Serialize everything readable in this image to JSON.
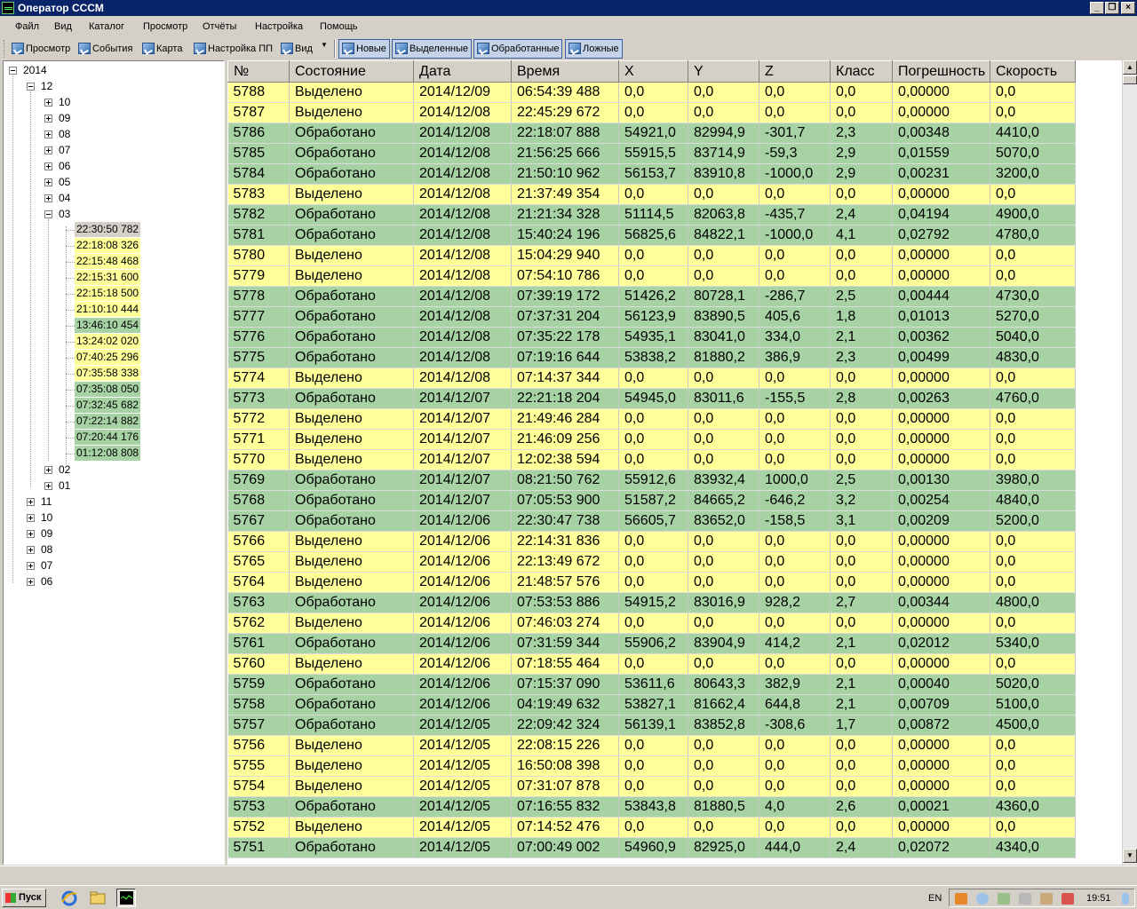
{
  "window": {
    "title": "Оператор СССМ"
  },
  "menu": [
    "Файл",
    "Вид",
    "Каталог",
    "Просмотр",
    "Отчёты",
    "Настройка",
    "Помощь"
  ],
  "toolbar": {
    "buttons": [
      "Просмотр",
      "События",
      "Карта",
      "Настройка ПП",
      "Вид"
    ],
    "filters": [
      "Новые",
      "Выделенные",
      "Обработанные",
      "Ложные"
    ]
  },
  "tree": {
    "year": "2014",
    "month_open": "12",
    "days_collapsed_top": [
      "10",
      "09",
      "08",
      "07",
      "06",
      "05",
      "04"
    ],
    "day_open": "03",
    "events": [
      {
        "t": "22:30:50 782",
        "status": "yellow",
        "selected": true
      },
      {
        "t": "22:18:08 326",
        "status": "yellow"
      },
      {
        "t": "22:15:48 468",
        "status": "yellow"
      },
      {
        "t": "22:15:31 600",
        "status": "yellow"
      },
      {
        "t": "22:15:18 500",
        "status": "yellow"
      },
      {
        "t": "21:10:10 444",
        "status": "yellow"
      },
      {
        "t": "13:46:10 454",
        "status": "green"
      },
      {
        "t": "13:24:02 020",
        "status": "yellow"
      },
      {
        "t": "07:40:25 296",
        "status": "yellow"
      },
      {
        "t": "07:35:58 338",
        "status": "yellow"
      },
      {
        "t": "07:35:08 050",
        "status": "green"
      },
      {
        "t": "07:32:45 682",
        "status": "green"
      },
      {
        "t": "07:22:14 882",
        "status": "green"
      },
      {
        "t": "07:20:44 176",
        "status": "green"
      },
      {
        "t": "01:12:08 808",
        "status": "green"
      }
    ],
    "days_collapsed_bottom": [
      "02",
      "01"
    ],
    "months_collapsed": [
      "11",
      "10",
      "09",
      "08",
      "07",
      "06"
    ]
  },
  "table": {
    "columns": [
      "№",
      "Состояние",
      "Дата",
      "Время",
      "X",
      "Y",
      "Z",
      "Класс",
      "Погрешность",
      "Скорость"
    ],
    "rows": [
      [
        "5788",
        "Выделено",
        "2014/12/09",
        "06:54:39 488",
        "0,0",
        "0,0",
        "0,0",
        "0,0",
        "0,00000",
        "0,0"
      ],
      [
        "5787",
        "Выделено",
        "2014/12/08",
        "22:45:29 672",
        "0,0",
        "0,0",
        "0,0",
        "0,0",
        "0,00000",
        "0,0"
      ],
      [
        "5786",
        "Обработано",
        "2014/12/08",
        "22:18:07 888",
        "54921,0",
        "82994,9",
        "-301,7",
        "2,3",
        "0,00348",
        "4410,0"
      ],
      [
        "5785",
        "Обработано",
        "2014/12/08",
        "21:56:25 666",
        "55915,5",
        "83714,9",
        "-59,3",
        "2,9",
        "0,01559",
        "5070,0"
      ],
      [
        "5784",
        "Обработано",
        "2014/12/08",
        "21:50:10 962",
        "56153,7",
        "83910,8",
        "-1000,0",
        "2,9",
        "0,00231",
        "3200,0"
      ],
      [
        "5783",
        "Выделено",
        "2014/12/08",
        "21:37:49 354",
        "0,0",
        "0,0",
        "0,0",
        "0,0",
        "0,00000",
        "0,0"
      ],
      [
        "5782",
        "Обработано",
        "2014/12/08",
        "21:21:34 328",
        "51114,5",
        "82063,8",
        "-435,7",
        "2,4",
        "0,04194",
        "4900,0"
      ],
      [
        "5781",
        "Обработано",
        "2014/12/08",
        "15:40:24 196",
        "56825,6",
        "84822,1",
        "-1000,0",
        "4,1",
        "0,02792",
        "4780,0"
      ],
      [
        "5780",
        "Выделено",
        "2014/12/08",
        "15:04:29 940",
        "0,0",
        "0,0",
        "0,0",
        "0,0",
        "0,00000",
        "0,0"
      ],
      [
        "5779",
        "Выделено",
        "2014/12/08",
        "07:54:10 786",
        "0,0",
        "0,0",
        "0,0",
        "0,0",
        "0,00000",
        "0,0"
      ],
      [
        "5778",
        "Обработано",
        "2014/12/08",
        "07:39:19 172",
        "51426,2",
        "80728,1",
        "-286,7",
        "2,5",
        "0,00444",
        "4730,0"
      ],
      [
        "5777",
        "Обработано",
        "2014/12/08",
        "07:37:31 204",
        "56123,9",
        "83890,5",
        "405,6",
        "1,8",
        "0,01013",
        "5270,0"
      ],
      [
        "5776",
        "Обработано",
        "2014/12/08",
        "07:35:22 178",
        "54935,1",
        "83041,0",
        "334,0",
        "2,1",
        "0,00362",
        "5040,0"
      ],
      [
        "5775",
        "Обработано",
        "2014/12/08",
        "07:19:16 644",
        "53838,2",
        "81880,2",
        "386,9",
        "2,3",
        "0,00499",
        "4830,0"
      ],
      [
        "5774",
        "Выделено",
        "2014/12/08",
        "07:14:37 344",
        "0,0",
        "0,0",
        "0,0",
        "0,0",
        "0,00000",
        "0,0"
      ],
      [
        "5773",
        "Обработано",
        "2014/12/07",
        "22:21:18 204",
        "54945,0",
        "83011,6",
        "-155,5",
        "2,8",
        "0,00263",
        "4760,0"
      ],
      [
        "5772",
        "Выделено",
        "2014/12/07",
        "21:49:46 284",
        "0,0",
        "0,0",
        "0,0",
        "0,0",
        "0,00000",
        "0,0"
      ],
      [
        "5771",
        "Выделено",
        "2014/12/07",
        "21:46:09 256",
        "0,0",
        "0,0",
        "0,0",
        "0,0",
        "0,00000",
        "0,0"
      ],
      [
        "5770",
        "Выделено",
        "2014/12/07",
        "12:02:38 594",
        "0,0",
        "0,0",
        "0,0",
        "0,0",
        "0,00000",
        "0,0"
      ],
      [
        "5769",
        "Обработано",
        "2014/12/07",
        "08:21:50 762",
        "55912,6",
        "83932,4",
        "1000,0",
        "2,5",
        "0,00130",
        "3980,0"
      ],
      [
        "5768",
        "Обработано",
        "2014/12/07",
        "07:05:53 900",
        "51587,2",
        "84665,2",
        "-646,2",
        "3,2",
        "0,00254",
        "4840,0"
      ],
      [
        "5767",
        "Обработано",
        "2014/12/06",
        "22:30:47 738",
        "56605,7",
        "83652,0",
        "-158,5",
        "3,1",
        "0,00209",
        "5200,0"
      ],
      [
        "5766",
        "Выделено",
        "2014/12/06",
        "22:14:31 836",
        "0,0",
        "0,0",
        "0,0",
        "0,0",
        "0,00000",
        "0,0"
      ],
      [
        "5765",
        "Выделено",
        "2014/12/06",
        "22:13:49 672",
        "0,0",
        "0,0",
        "0,0",
        "0,0",
        "0,00000",
        "0,0"
      ],
      [
        "5764",
        "Выделено",
        "2014/12/06",
        "21:48:57 576",
        "0,0",
        "0,0",
        "0,0",
        "0,0",
        "0,00000",
        "0,0"
      ],
      [
        "5763",
        "Обработано",
        "2014/12/06",
        "07:53:53 886",
        "54915,2",
        "83016,9",
        "928,2",
        "2,7",
        "0,00344",
        "4800,0"
      ],
      [
        "5762",
        "Выделено",
        "2014/12/06",
        "07:46:03 274",
        "0,0",
        "0,0",
        "0,0",
        "0,0",
        "0,00000",
        "0,0"
      ],
      [
        "5761",
        "Обработано",
        "2014/12/06",
        "07:31:59 344",
        "55906,2",
        "83904,9",
        "414,2",
        "2,1",
        "0,02012",
        "5340,0"
      ],
      [
        "5760",
        "Выделено",
        "2014/12/06",
        "07:18:55 464",
        "0,0",
        "0,0",
        "0,0",
        "0,0",
        "0,00000",
        "0,0"
      ],
      [
        "5759",
        "Обработано",
        "2014/12/06",
        "07:15:37 090",
        "53611,6",
        "80643,3",
        "382,9",
        "2,1",
        "0,00040",
        "5020,0"
      ],
      [
        "5758",
        "Обработано",
        "2014/12/06",
        "04:19:49 632",
        "53827,1",
        "81662,4",
        "644,8",
        "2,1",
        "0,00709",
        "5100,0"
      ],
      [
        "5757",
        "Обработано",
        "2014/12/05",
        "22:09:42 324",
        "56139,1",
        "83852,8",
        "-308,6",
        "1,7",
        "0,00872",
        "4500,0"
      ],
      [
        "5756",
        "Выделено",
        "2014/12/05",
        "22:08:15 226",
        "0,0",
        "0,0",
        "0,0",
        "0,0",
        "0,00000",
        "0,0"
      ],
      [
        "5755",
        "Выделено",
        "2014/12/05",
        "16:50:08 398",
        "0,0",
        "0,0",
        "0,0",
        "0,0",
        "0,00000",
        "0,0"
      ],
      [
        "5754",
        "Выделено",
        "2014/12/05",
        "07:31:07 878",
        "0,0",
        "0,0",
        "0,0",
        "0,0",
        "0,00000",
        "0,0"
      ],
      [
        "5753",
        "Обработано",
        "2014/12/05",
        "07:16:55 832",
        "53843,8",
        "81880,5",
        "4,0",
        "2,6",
        "0,00021",
        "4360,0"
      ],
      [
        "5752",
        "Выделено",
        "2014/12/05",
        "07:14:52 476",
        "0,0",
        "0,0",
        "0,0",
        "0,0",
        "0,00000",
        "0,0"
      ],
      [
        "5751",
        "Обработано",
        "2014/12/05",
        "07:00:49 002",
        "54960,9",
        "82925,0",
        "444,0",
        "2,4",
        "0,02072",
        "4340,0"
      ]
    ]
  },
  "colors": {
    "selected_row": "#ffff99",
    "processed_row": "#a7d3a4",
    "titlebar": "#0a246a"
  },
  "taskbar": {
    "start_label": "Пуск",
    "language": "EN",
    "clock": "19:51"
  }
}
